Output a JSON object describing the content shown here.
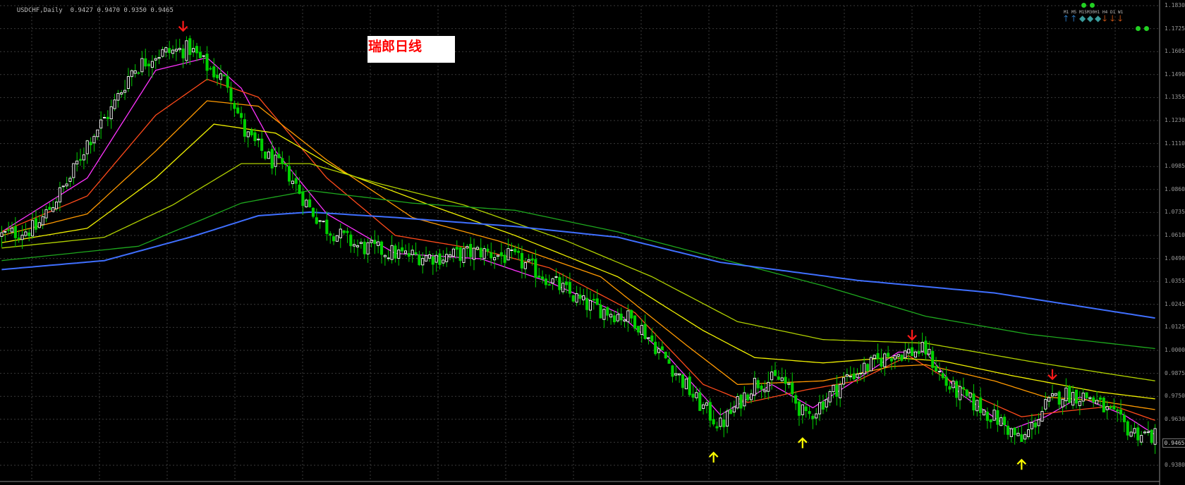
{
  "header": {
    "symbol_period": "USDCHF,Daily",
    "ohlc": "0.9427 0.9470 0.9350 0.9465"
  },
  "title": "瑞郎日线",
  "colors": {
    "background": "#000000",
    "grid": "#3a3a3a",
    "bull_candle": "#ffffff",
    "bear_candle": "#00d000",
    "up_arrow": "#ffff00",
    "down_arrow": "#ff1a1a"
  },
  "price_axis": {
    "ticks": [
      "1.1830",
      "1.1725",
      "1.1605",
      "1.1490",
      "1.1355",
      "1.1230",
      "1.1110",
      "1.0985",
      "1.0860",
      "1.0735",
      "1.0610",
      "1.0490",
      "1.0355",
      "1.0245",
      "1.0125",
      "1.0000",
      "0.9875",
      "0.9750",
      "0.9630",
      "0.9505",
      "0.9380"
    ],
    "current_price": "0.9465"
  },
  "dashboard": {
    "timeframes": [
      "M1",
      "M5",
      "M15",
      "M30",
      "H1",
      "H4",
      "D1",
      "W1"
    ],
    "signals": [
      {
        "glyph": "🡑",
        "color": "#3aa0ff",
        "name": "m1-signal-up-icon"
      },
      {
        "glyph": "🡑",
        "color": "#3aa0ff",
        "name": "m5-signal-up-icon"
      },
      {
        "glyph": "◆",
        "color": "#3a9c9c",
        "name": "m15-signal-neutral-icon"
      },
      {
        "glyph": "◆",
        "color": "#3a9c9c",
        "name": "m30-signal-neutral-icon"
      },
      {
        "glyph": "◆",
        "color": "#3a9c9c",
        "name": "h1-signal-neutral-icon"
      },
      {
        "glyph": "🡓",
        "color": "#ff6a1a",
        "name": "h4-signal-down-icon"
      },
      {
        "glyph": "🡓",
        "color": "#ff6a1a",
        "name": "d1-signal-down-icon"
      },
      {
        "glyph": "🡓",
        "color": "#ff6a1a",
        "name": "w1-signal-down-icon"
      }
    ]
  },
  "chart_data": {
    "type": "candlestick",
    "ylim": [
      0.93,
      1.186
    ],
    "grid": true,
    "bars": 338,
    "close_path": [
      [
        0,
        1.058
      ],
      [
        10,
        1.062
      ],
      [
        20,
        1.09
      ],
      [
        25,
        1.11
      ],
      [
        32,
        1.128
      ],
      [
        38,
        1.15
      ],
      [
        45,
        1.159
      ],
      [
        55,
        1.162
      ],
      [
        60,
        1.152
      ],
      [
        66,
        1.143
      ],
      [
        71,
        1.115
      ],
      [
        78,
        1.101
      ],
      [
        84,
        1.092
      ],
      [
        90,
        1.073
      ],
      [
        95,
        1.062
      ],
      [
        104,
        1.052
      ],
      [
        118,
        1.047
      ],
      [
        128,
        1.046
      ],
      [
        140,
        1.049
      ],
      [
        150,
        1.045
      ],
      [
        158,
        1.036
      ],
      [
        170,
        1.02
      ],
      [
        180,
        1.014
      ],
      [
        185,
        1.011
      ],
      [
        195,
        0.987
      ],
      [
        203,
        0.966
      ],
      [
        210,
        0.952
      ],
      [
        220,
        0.976
      ],
      [
        228,
        0.978
      ],
      [
        235,
        0.956
      ],
      [
        247,
        0.979
      ],
      [
        260,
        0.992
      ],
      [
        270,
        0.994
      ],
      [
        276,
        0.975
      ],
      [
        285,
        0.963
      ],
      [
        292,
        0.954
      ],
      [
        298,
        0.943
      ],
      [
        305,
        0.963
      ],
      [
        310,
        0.97
      ],
      [
        318,
        0.968
      ],
      [
        330,
        0.949
      ],
      [
        337,
        0.946
      ]
    ],
    "moving_averages": [
      {
        "color": "#ff33ff",
        "points": [
          [
            0,
            1.06
          ],
          [
            25,
            1.09
          ],
          [
            45,
            1.15
          ],
          [
            60,
            1.157
          ],
          [
            70,
            1.14
          ],
          [
            80,
            1.105
          ],
          [
            95,
            1.07
          ],
          [
            115,
            1.048
          ],
          [
            140,
            1.045
          ],
          [
            160,
            1.032
          ],
          [
            180,
            1.015
          ],
          [
            195,
            0.99
          ],
          [
            210,
            0.958
          ],
          [
            225,
            0.975
          ],
          [
            237,
            0.962
          ],
          [
            250,
            0.978
          ],
          [
            262,
            0.993
          ],
          [
            270,
            0.993
          ],
          [
            280,
            0.97
          ],
          [
            295,
            0.95
          ],
          [
            305,
            0.957
          ],
          [
            315,
            0.968
          ],
          [
            328,
            0.958
          ],
          [
            337,
            0.947
          ]
        ]
      },
      {
        "color": "#ff4a1a",
        "points": [
          [
            0,
            1.06
          ],
          [
            25,
            1.08
          ],
          [
            45,
            1.125
          ],
          [
            60,
            1.145
          ],
          [
            75,
            1.135
          ],
          [
            95,
            1.09
          ],
          [
            115,
            1.058
          ],
          [
            140,
            1.05
          ],
          [
            160,
            1.04
          ],
          [
            185,
            1.015
          ],
          [
            205,
            0.975
          ],
          [
            218,
            0.965
          ],
          [
            235,
            0.972
          ],
          [
            250,
            0.977
          ],
          [
            265,
            0.991
          ],
          [
            285,
            0.968
          ],
          [
            298,
            0.957
          ],
          [
            310,
            0.96
          ],
          [
            325,
            0.963
          ],
          [
            337,
            0.955
          ]
        ]
      },
      {
        "color": "#ff9900",
        "points": [
          [
            0,
            1.058
          ],
          [
            25,
            1.07
          ],
          [
            45,
            1.105
          ],
          [
            60,
            1.133
          ],
          [
            75,
            1.13
          ],
          [
            95,
            1.1
          ],
          [
            120,
            1.068
          ],
          [
            145,
            1.055
          ],
          [
            175,
            1.035
          ],
          [
            200,
            0.997
          ],
          [
            215,
            0.975
          ],
          [
            240,
            0.977
          ],
          [
            260,
            0.985
          ],
          [
            270,
            0.986
          ],
          [
            290,
            0.977
          ],
          [
            305,
            0.968
          ],
          [
            320,
            0.966
          ],
          [
            337,
            0.961
          ]
        ]
      },
      {
        "color": "#f0f000",
        "points": [
          [
            0,
            1.054
          ],
          [
            25,
            1.062
          ],
          [
            45,
            1.09
          ],
          [
            62,
            1.12
          ],
          [
            80,
            1.115
          ],
          [
            100,
            1.093
          ],
          [
            125,
            1.075
          ],
          [
            150,
            1.058
          ],
          [
            180,
            1.035
          ],
          [
            205,
            1.005
          ],
          [
            220,
            0.99
          ],
          [
            240,
            0.987
          ],
          [
            260,
            0.99
          ],
          [
            275,
            0.988
          ],
          [
            295,
            0.98
          ],
          [
            320,
            0.971
          ],
          [
            337,
            0.967
          ]
        ]
      },
      {
        "color": "#b0d000",
        "points": [
          [
            0,
            1.051
          ],
          [
            30,
            1.057
          ],
          [
            50,
            1.075
          ],
          [
            70,
            1.098
          ],
          [
            90,
            1.098
          ],
          [
            110,
            1.087
          ],
          [
            135,
            1.075
          ],
          [
            165,
            1.055
          ],
          [
            190,
            1.035
          ],
          [
            215,
            1.01
          ],
          [
            240,
            1.0
          ],
          [
            270,
            0.998
          ],
          [
            300,
            0.988
          ],
          [
            320,
            0.982
          ],
          [
            337,
            0.977
          ]
        ]
      },
      {
        "color": "#1ea81e",
        "points": [
          [
            0,
            1.044
          ],
          [
            40,
            1.052
          ],
          [
            70,
            1.076
          ],
          [
            90,
            1.083
          ],
          [
            120,
            1.076
          ],
          [
            150,
            1.072
          ],
          [
            180,
            1.06
          ],
          [
            210,
            1.045
          ],
          [
            240,
            1.03
          ],
          [
            270,
            1.013
          ],
          [
            300,
            1.003
          ],
          [
            337,
            0.995
          ]
        ]
      },
      {
        "color": "#3f6fff",
        "points": [
          [
            0,
            1.039
          ],
          [
            30,
            1.044
          ],
          [
            55,
            1.057
          ],
          [
            75,
            1.069
          ],
          [
            90,
            1.071
          ],
          [
            115,
            1.068
          ],
          [
            150,
            1.063
          ],
          [
            180,
            1.057
          ],
          [
            210,
            1.043
          ],
          [
            250,
            1.033
          ],
          [
            290,
            1.026
          ],
          [
            337,
            1.012
          ]
        ]
      }
    ],
    "signal_arrows": [
      {
        "bar": 53,
        "direction": "down",
        "price": 1.172
      },
      {
        "bar": 208,
        "direction": "up",
        "price": 0.937
      },
      {
        "bar": 234,
        "direction": "up",
        "price": 0.945
      },
      {
        "bar": 266,
        "direction": "down",
        "price": 1.0
      },
      {
        "bar": 307,
        "direction": "down",
        "price": 0.978
      },
      {
        "bar": 298,
        "direction": "up",
        "price": 0.933
      }
    ]
  }
}
